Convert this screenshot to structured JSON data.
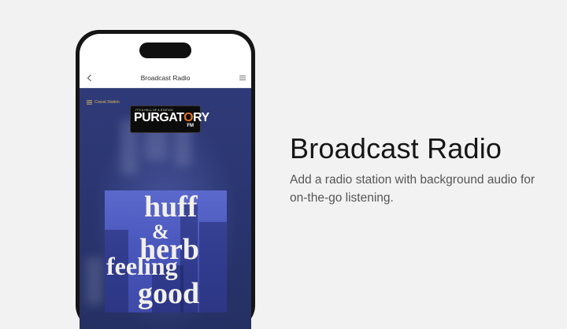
{
  "phone": {
    "app_bar": {
      "title": "Broadcast Radio",
      "back_icon": "chevron-left-icon",
      "menu_icon": "hamburger-menu-icon"
    },
    "player": {
      "stations_label": "Cravat Station",
      "stations_icon": "list-icon",
      "station_logo": {
        "tagline": "IT'S A HELL OF A STATION",
        "name_left": "PURGAT",
        "name_o": "O",
        "name_right": "RY",
        "sub": "FM"
      },
      "album_art": {
        "line1": "huff",
        "line2": "&",
        "line3": "herb",
        "line4": "feeling",
        "line5": "good"
      }
    }
  },
  "hero": {
    "title": "Broadcast Radio",
    "description": "Add a radio station with background audio for on-the-go listening."
  },
  "colors": {
    "page_bg": "#f2f2f2",
    "player_bg": "#2b3670",
    "accent_gold": "#d8b85a",
    "logo_orange": "#e8731c"
  }
}
